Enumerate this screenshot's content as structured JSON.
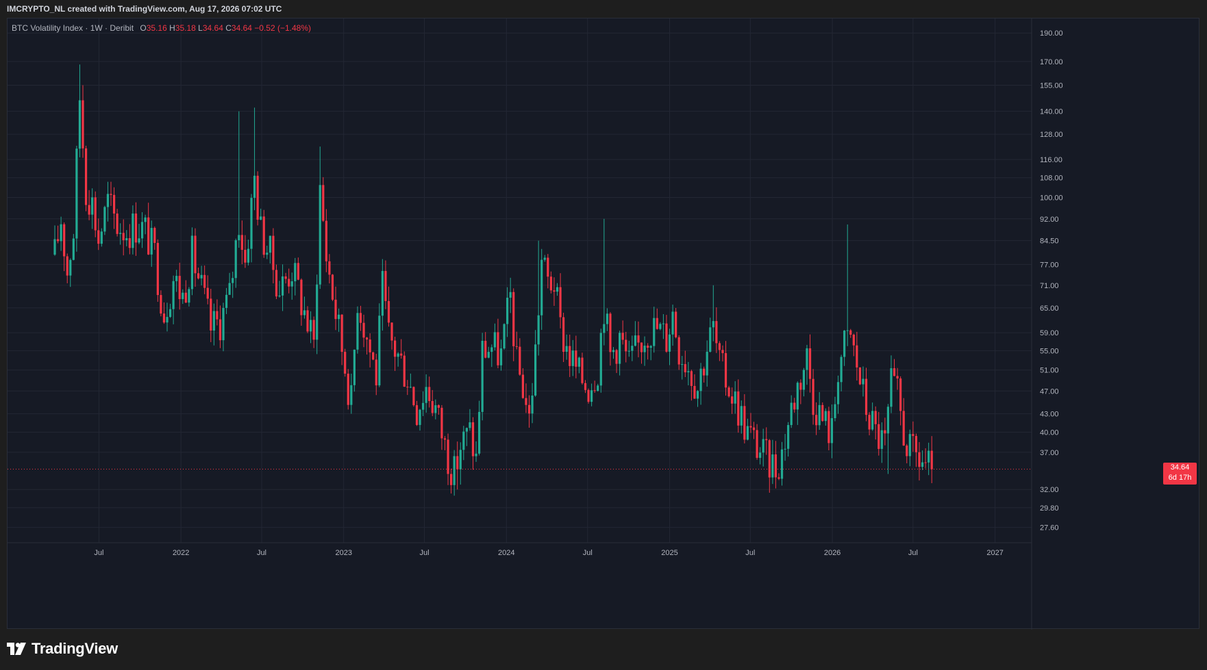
{
  "header": {
    "text": "IMCRYPTO_NL created with TradingView.com, Aug 17, 2026 07:02 UTC"
  },
  "legend": {
    "symbol": "BTC Volatility Index · 1W · Deribit",
    "o_label": "O",
    "o_value": "35.16",
    "h_label": "H",
    "h_value": "35.18",
    "l_label": "L",
    "l_value": "34.64",
    "c_label": "C",
    "c_value": "34.64",
    "change": "−0.52 (−1.48%)"
  },
  "price_tag": {
    "price": "34.64",
    "countdown": "6d 17h"
  },
  "footer": {
    "brand": "TradingView",
    "logo_icon": "tradingview-logo-icon"
  },
  "colors": {
    "up": "#22ab94",
    "down": "#f23645",
    "background": "#161a25",
    "grid": "#232734",
    "text": "#b2b5be"
  },
  "chart_data": {
    "type": "candlestick",
    "title": "BTC Volatility Index · 1W · Deribit",
    "interval": "1W",
    "y_scale": "log",
    "grid": true,
    "y_ticks": [
      27.6,
      29.8,
      32.0,
      37.0,
      40.0,
      43.0,
      47.0,
      51.0,
      55.0,
      59.0,
      65.0,
      71.0,
      77.0,
      84.5,
      92.0,
      100.0,
      108.0,
      116.0,
      128.0,
      140.0,
      155.0,
      170.0,
      190.0
    ],
    "x_ticks": [
      {
        "label": "Jul",
        "date": "2021-07-01"
      },
      {
        "label": "2022",
        "date": "2022-01-01"
      },
      {
        "label": "Jul",
        "date": "2022-07-01"
      },
      {
        "label": "2023",
        "date": "2023-01-01"
      },
      {
        "label": "Jul",
        "date": "2023-07-01"
      },
      {
        "label": "2024",
        "date": "2024-01-01"
      },
      {
        "label": "Jul",
        "date": "2024-07-01"
      },
      {
        "label": "2025",
        "date": "2025-01-01"
      },
      {
        "label": "Jul",
        "date": "2025-07-01"
      },
      {
        "label": "2026",
        "date": "2026-01-01"
      },
      {
        "label": "Jul",
        "date": "2026-07-01"
      },
      {
        "label": "2027",
        "date": "2027-01-01"
      }
    ],
    "x_range": [
      "2020-12-08",
      "2027-03-24"
    ],
    "y_range": [
      26.0,
      200.0
    ],
    "last_price": 34.64,
    "anchors": [
      [
        "2021-03-24",
        80
      ],
      [
        "2021-04-07",
        92
      ],
      [
        "2021-04-21",
        75
      ],
      [
        "2021-05-05",
        88
      ],
      [
        "2021-05-19",
        148
      ],
      [
        "2021-06-02",
        104
      ],
      [
        "2021-06-16",
        98
      ],
      [
        "2021-06-30",
        85
      ],
      [
        "2021-07-21",
        98
      ],
      [
        "2021-08-11",
        90
      ],
      [
        "2021-09-01",
        88
      ],
      [
        "2021-09-22",
        90
      ],
      [
        "2021-10-13",
        88
      ],
      [
        "2021-11-03",
        80
      ],
      [
        "2021-11-24",
        64
      ],
      [
        "2021-12-15",
        73
      ],
      [
        "2022-01-05",
        68
      ],
      [
        "2022-01-26",
        80
      ],
      [
        "2022-02-16",
        70
      ],
      [
        "2022-03-09",
        60
      ],
      [
        "2022-03-30",
        62
      ],
      [
        "2022-04-20",
        68
      ],
      [
        "2022-05-11",
        92
      ],
      [
        "2022-05-25",
        78
      ],
      [
        "2022-06-15",
        108
      ],
      [
        "2022-06-29",
        88
      ],
      [
        "2022-07-20",
        80
      ],
      [
        "2022-08-10",
        70
      ],
      [
        "2022-09-07",
        76
      ],
      [
        "2022-10-05",
        64
      ],
      [
        "2022-10-26",
        56
      ],
      [
        "2022-11-09",
        104
      ],
      [
        "2022-11-23",
        80
      ],
      [
        "2022-12-14",
        64
      ],
      [
        "2023-01-04",
        52
      ],
      [
        "2023-01-18",
        45
      ],
      [
        "2023-02-01",
        68
      ],
      [
        "2023-02-22",
        58
      ],
      [
        "2023-03-15",
        50
      ],
      [
        "2023-03-29",
        70
      ],
      [
        "2023-04-12",
        58
      ],
      [
        "2023-05-03",
        54
      ],
      [
        "2023-05-24",
        50
      ],
      [
        "2023-06-14",
        44
      ],
      [
        "2023-07-05",
        48
      ],
      [
        "2023-07-26",
        44
      ],
      [
        "2023-08-16",
        38
      ],
      [
        "2023-09-06",
        34
      ],
      [
        "2023-09-20",
        38
      ],
      [
        "2023-10-11",
        40
      ],
      [
        "2023-10-25",
        36
      ],
      [
        "2023-11-08",
        55
      ],
      [
        "2023-11-29",
        56
      ],
      [
        "2023-12-20",
        54
      ],
      [
        "2024-01-10",
        68
      ],
      [
        "2024-01-24",
        52
      ],
      [
        "2024-02-07",
        48
      ],
      [
        "2024-02-21",
        42
      ],
      [
        "2024-03-06",
        55
      ],
      [
        "2024-03-20",
        78
      ],
      [
        "2024-04-03",
        72
      ],
      [
        "2024-04-17",
        72
      ],
      [
        "2024-05-01",
        60
      ],
      [
        "2024-05-22",
        54
      ],
      [
        "2024-06-12",
        50
      ],
      [
        "2024-07-03",
        48
      ],
      [
        "2024-07-24",
        52
      ],
      [
        "2024-08-07",
        66
      ],
      [
        "2024-08-21",
        54
      ],
      [
        "2024-09-11",
        58
      ],
      [
        "2024-10-02",
        52
      ],
      [
        "2024-10-23",
        56
      ],
      [
        "2024-11-13",
        60
      ],
      [
        "2024-12-04",
        60
      ],
      [
        "2024-12-25",
        58
      ],
      [
        "2025-01-08",
        64
      ],
      [
        "2025-01-22",
        56
      ],
      [
        "2025-02-12",
        52
      ],
      [
        "2025-03-05",
        48
      ],
      [
        "2025-03-26",
        56
      ],
      [
        "2025-04-09",
        60
      ],
      [
        "2025-04-23",
        52
      ],
      [
        "2025-05-14",
        48
      ],
      [
        "2025-06-04",
        44
      ],
      [
        "2025-06-25",
        40
      ],
      [
        "2025-07-16",
        38
      ],
      [
        "2025-08-06",
        36
      ],
      [
        "2025-08-27",
        35
      ],
      [
        "2025-09-10",
        37
      ],
      [
        "2025-10-01",
        44
      ],
      [
        "2025-10-15",
        48
      ],
      [
        "2025-11-05",
        54
      ],
      [
        "2025-11-19",
        46
      ],
      [
        "2025-12-10",
        42
      ],
      [
        "2025-12-31",
        40
      ],
      [
        "2026-01-14",
        52
      ],
      [
        "2026-01-28",
        56
      ],
      [
        "2026-02-11",
        58
      ],
      [
        "2026-02-25",
        52
      ],
      [
        "2026-03-18",
        44
      ],
      [
        "2026-04-08",
        40
      ],
      [
        "2026-04-29",
        38
      ],
      [
        "2026-05-13",
        48
      ],
      [
        "2026-05-27",
        46
      ],
      [
        "2026-06-10",
        40
      ],
      [
        "2026-06-24",
        37
      ],
      [
        "2026-07-15",
        36
      ],
      [
        "2026-08-12",
        34.64
      ]
    ],
    "spikes": [
      {
        "date": "2021-05-19",
        "high": 168
      },
      {
        "date": "2021-05-26",
        "high": 155
      },
      {
        "date": "2022-05-11",
        "high": 140
      },
      {
        "date": "2022-06-15",
        "high": 142
      },
      {
        "date": "2022-11-09",
        "high": 122
      },
      {
        "date": "2024-03-13",
        "high": 84.5
      },
      {
        "date": "2024-08-07",
        "high": 92
      },
      {
        "date": "2025-04-09",
        "high": 71
      },
      {
        "date": "2026-02-04",
        "high": 90
      },
      {
        "date": "2026-05-13",
        "high": 54
      }
    ],
    "dips": [
      {
        "date": "2023-08-30",
        "low": 31.5
      },
      {
        "date": "2023-09-13",
        "low": 32
      },
      {
        "date": "2025-09-03",
        "low": 33.2
      },
      {
        "date": "2026-05-06",
        "low": 34
      }
    ]
  }
}
